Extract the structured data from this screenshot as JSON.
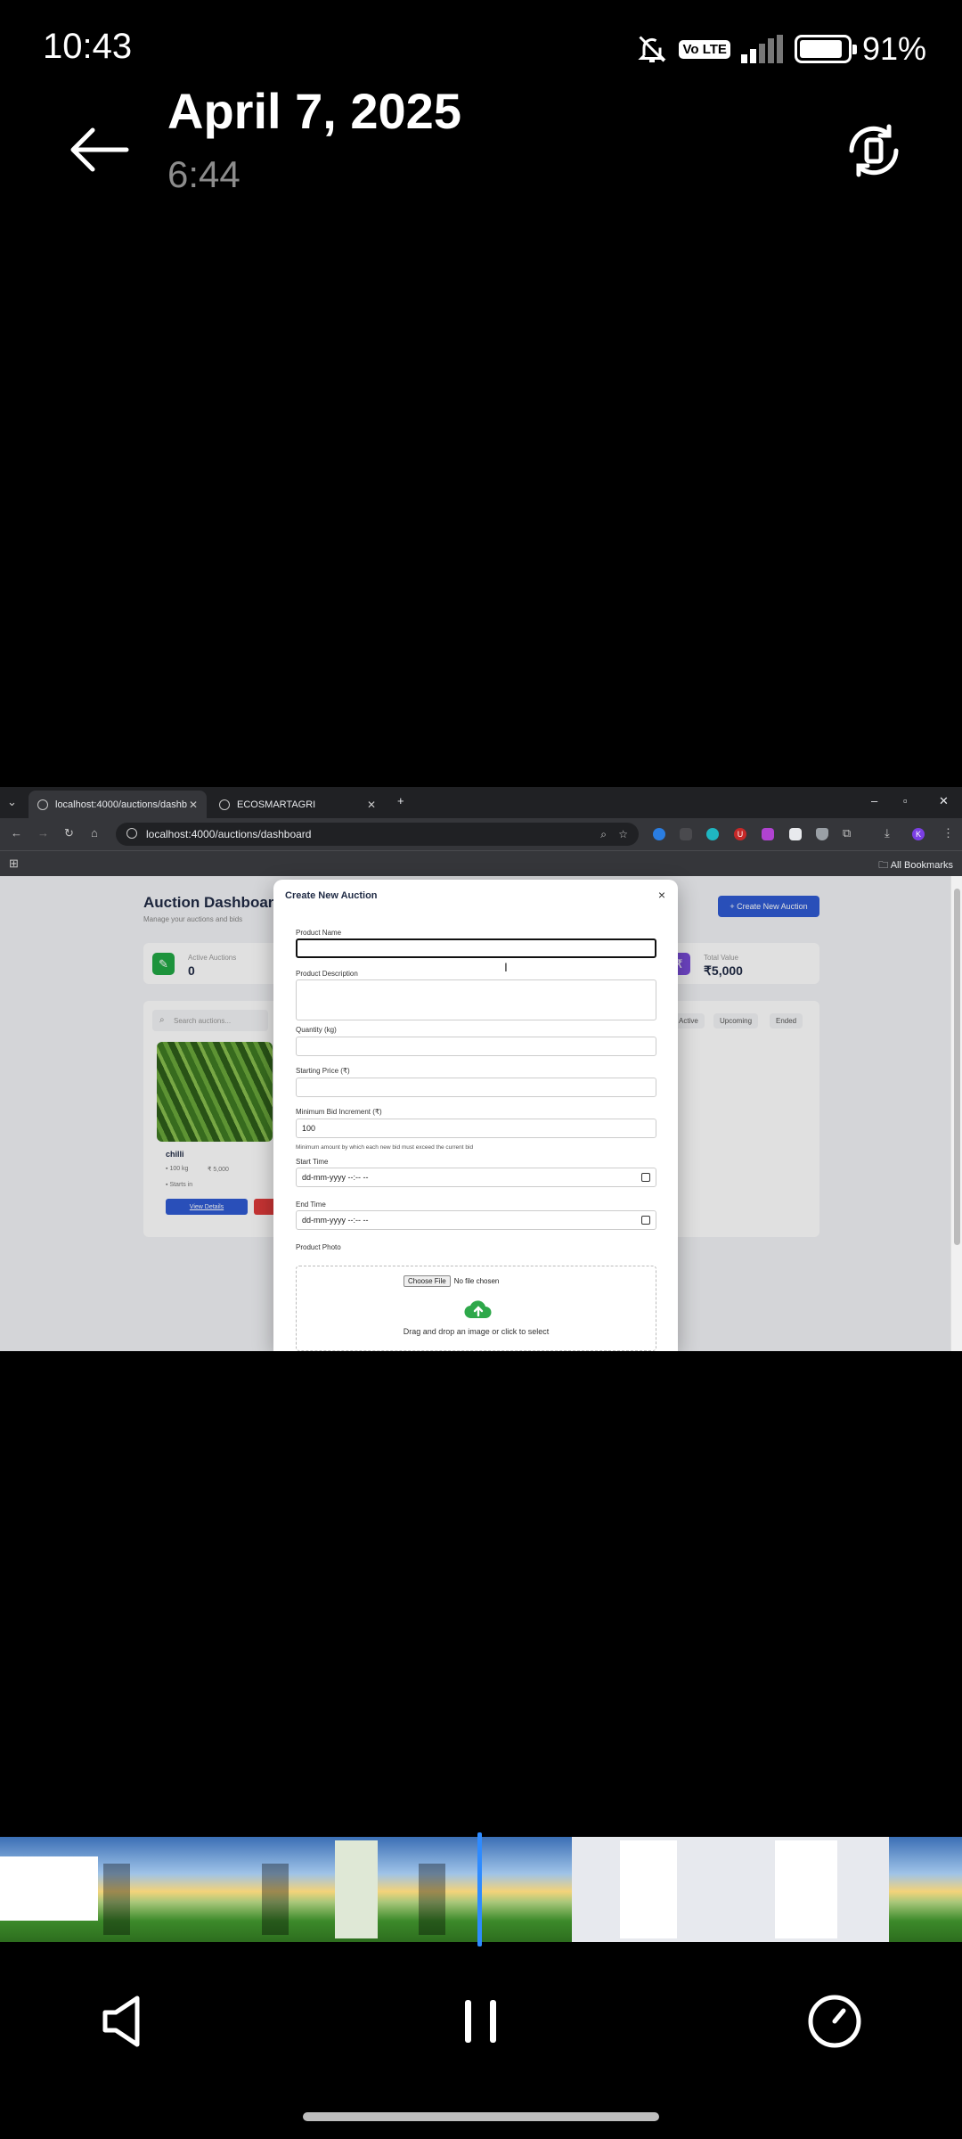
{
  "status_bar": {
    "time": "10:43",
    "volte": "Vo LTE",
    "battery_percent": "91%",
    "battery_level": 0.91
  },
  "viewer": {
    "date": "April 7, 2025",
    "time": "6:44"
  },
  "browser": {
    "tabs": [
      {
        "title": "localhost:4000/auctions/dashb"
      },
      {
        "title": "ECOSMARTAGRI"
      }
    ],
    "new_tab": "+",
    "url": "localhost:4000/auctions/dashboard",
    "all_bookmarks": "All Bookmarks",
    "profile_initial": "K",
    "ext_badge": "U"
  },
  "dashboard": {
    "title": "Auction Dashboard",
    "subtitle": "Manage your auctions and bids",
    "create_button": "+ Create New Auction",
    "stats": [
      {
        "label": "Active Auctions",
        "value": "0",
        "color": "#22a845"
      },
      {
        "label": "Total Value",
        "value": "₹5,000",
        "color": "#7c4ddc"
      }
    ],
    "search_placeholder": "Search auctions...",
    "filters": [
      "Active",
      "Upcoming",
      "Ended"
    ],
    "card": {
      "name": "chilli",
      "quantity": "100 kg",
      "price": "₹ 5,000",
      "starts": "Starts in",
      "view_button": "View Details"
    }
  },
  "modal": {
    "title": "Create New Auction",
    "close": "×",
    "fields": {
      "product_name": "Product Name",
      "product_description": "Product Description",
      "quantity": "Quantity (kg)",
      "starting_price": "Starting Price (₹)",
      "min_increment": "Minimum Bid Increment (₹)",
      "min_increment_value": "100",
      "min_increment_help": "Minimum amount by which each new bid must exceed the current bid",
      "start_time": "Start Time",
      "end_time": "End Time",
      "datetime_placeholder": "dd-mm-yyyy --:-- --",
      "product_photo": "Product Photo",
      "choose_file": "Choose File",
      "no_file": "No file chosen",
      "drop_text": "Drag and drop an image or click to select"
    }
  },
  "player": {
    "icons": [
      "volume-icon",
      "pause-icon",
      "speed-icon"
    ]
  },
  "colors": {
    "accent": "#2f5bd3",
    "playhead": "#2e8bff",
    "upload": "#2ea84a"
  }
}
